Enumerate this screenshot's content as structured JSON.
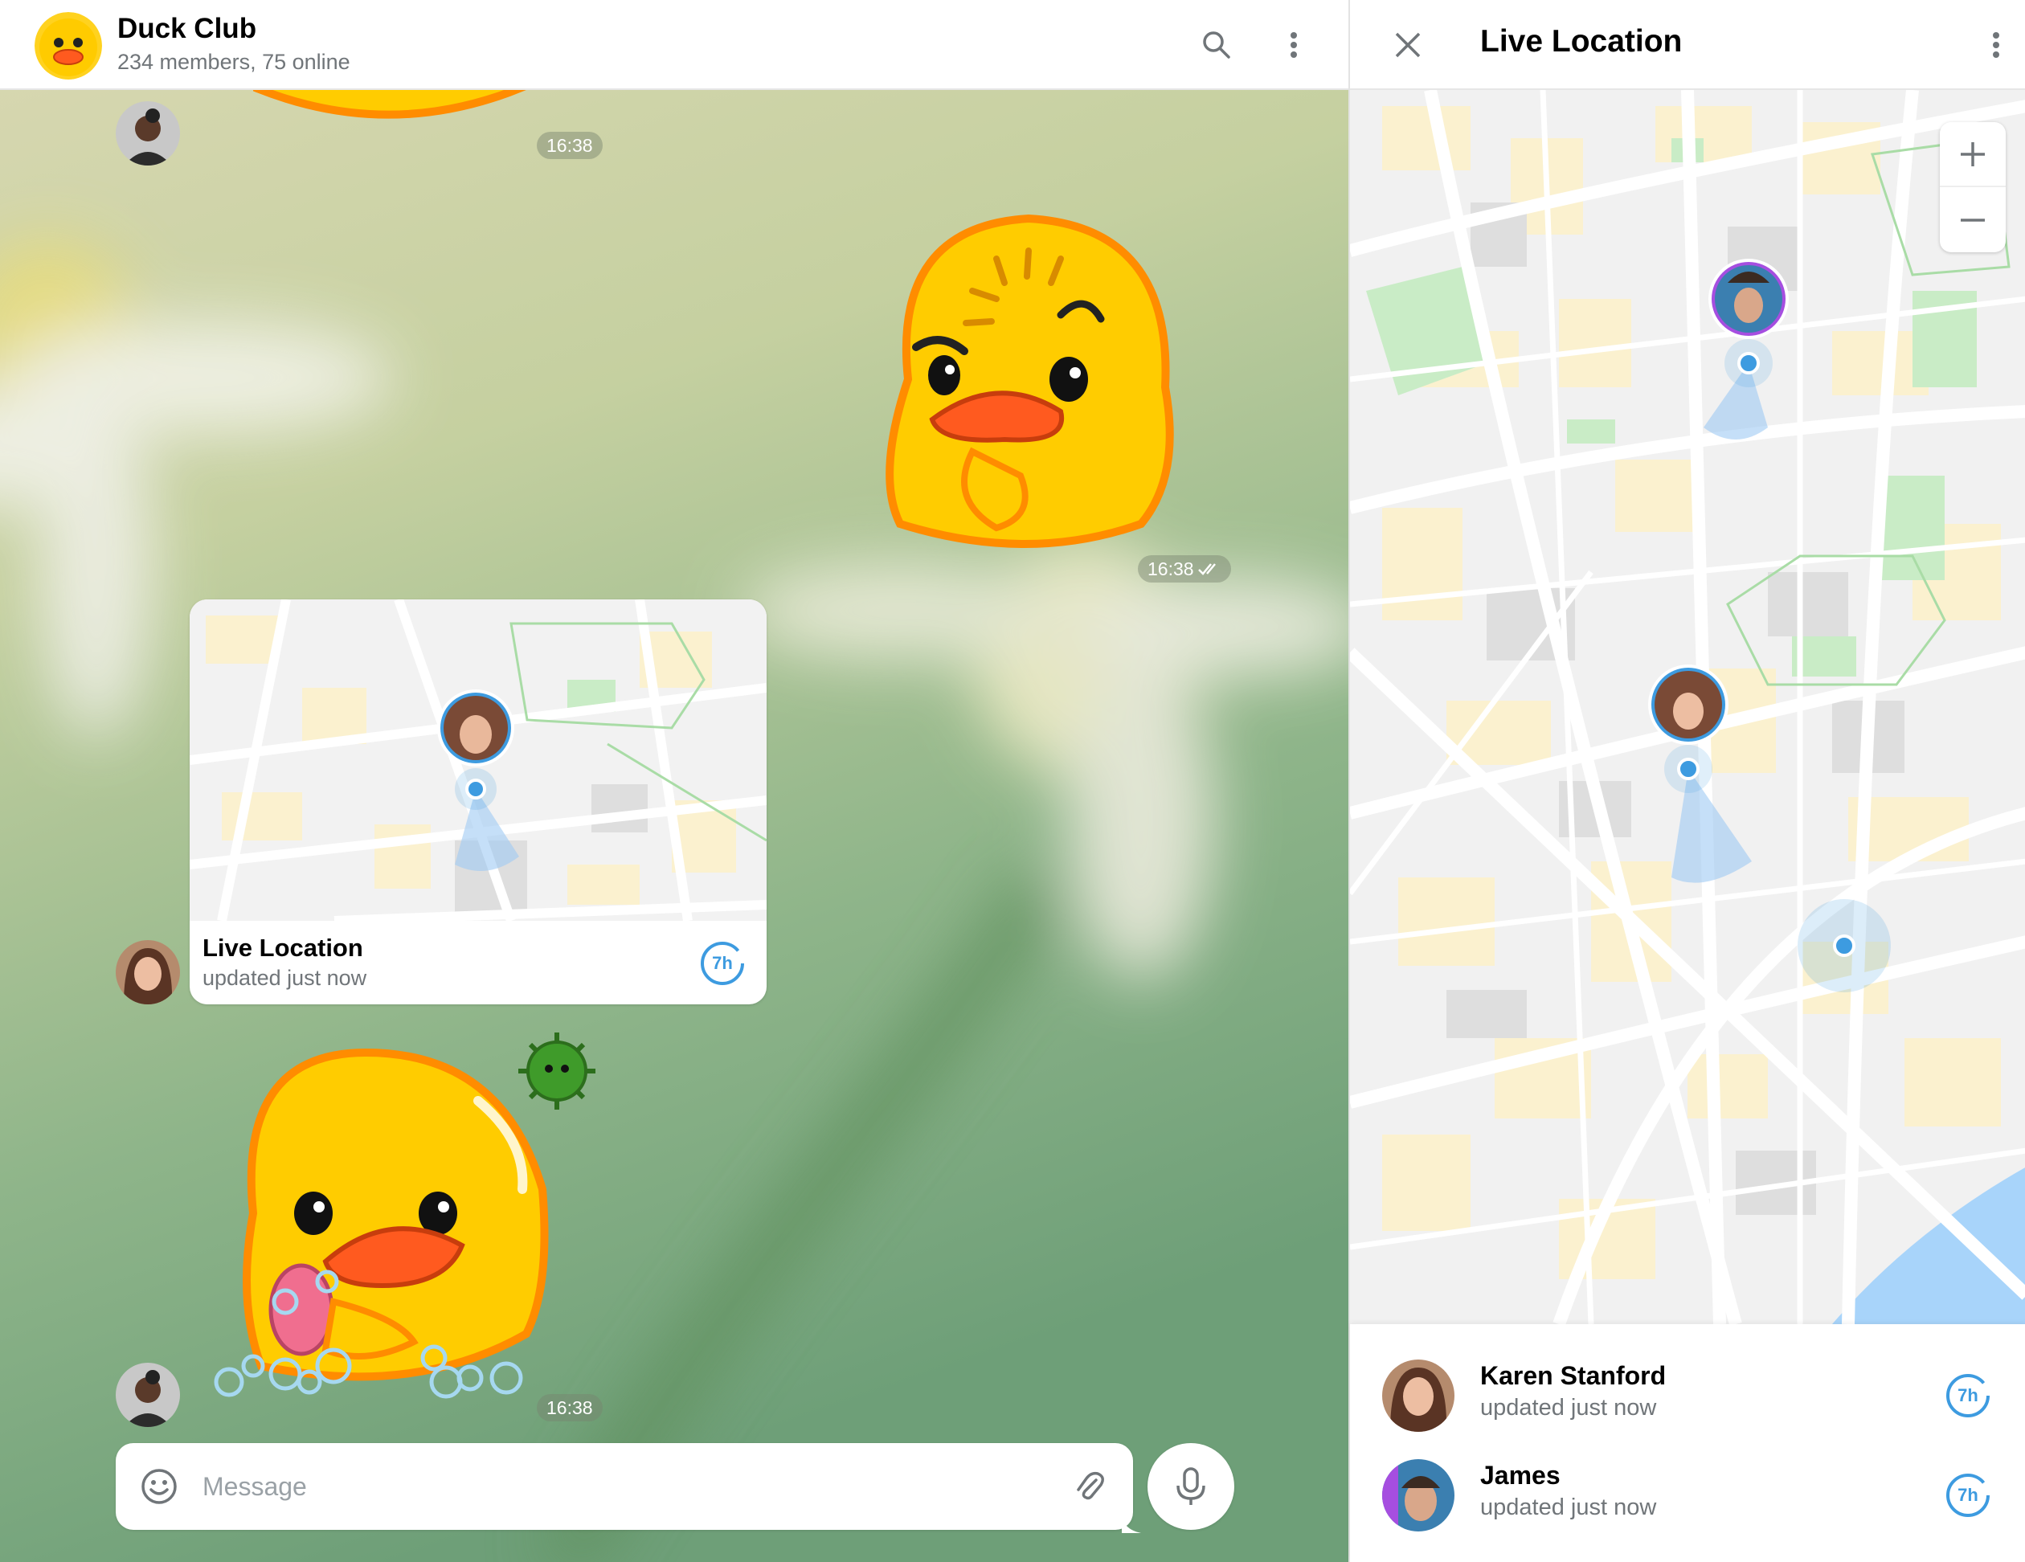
{
  "chat": {
    "title": "Duck Club",
    "subtitle": "234 members, 75 online",
    "messages": [
      {
        "type": "sticker",
        "time": "16:38"
      },
      {
        "type": "sticker",
        "time": "16:38",
        "outgoing": true
      },
      {
        "type": "location",
        "title": "Live Location",
        "subtitle": "updated just now",
        "timer": "7h"
      },
      {
        "type": "sticker",
        "time": "16:38"
      }
    ],
    "composer": {
      "placeholder": "Message"
    }
  },
  "panel": {
    "title": "Live Location",
    "people": [
      {
        "name": "Karen Stanford",
        "status": "updated just now",
        "timer": "7h"
      },
      {
        "name": "James",
        "status": "updated just now",
        "timer": "7h"
      }
    ]
  },
  "colors": {
    "accent": "#3d9be0",
    "map_water": "#a8d4fa",
    "map_park": "#c9ecc6",
    "map_block": "#fbf1cf"
  },
  "icons": [
    "search-icon",
    "more-vertical-icon",
    "close-icon",
    "emoji-icon",
    "attach-icon",
    "mic-icon",
    "zoom-in-icon",
    "zoom-out-icon"
  ]
}
